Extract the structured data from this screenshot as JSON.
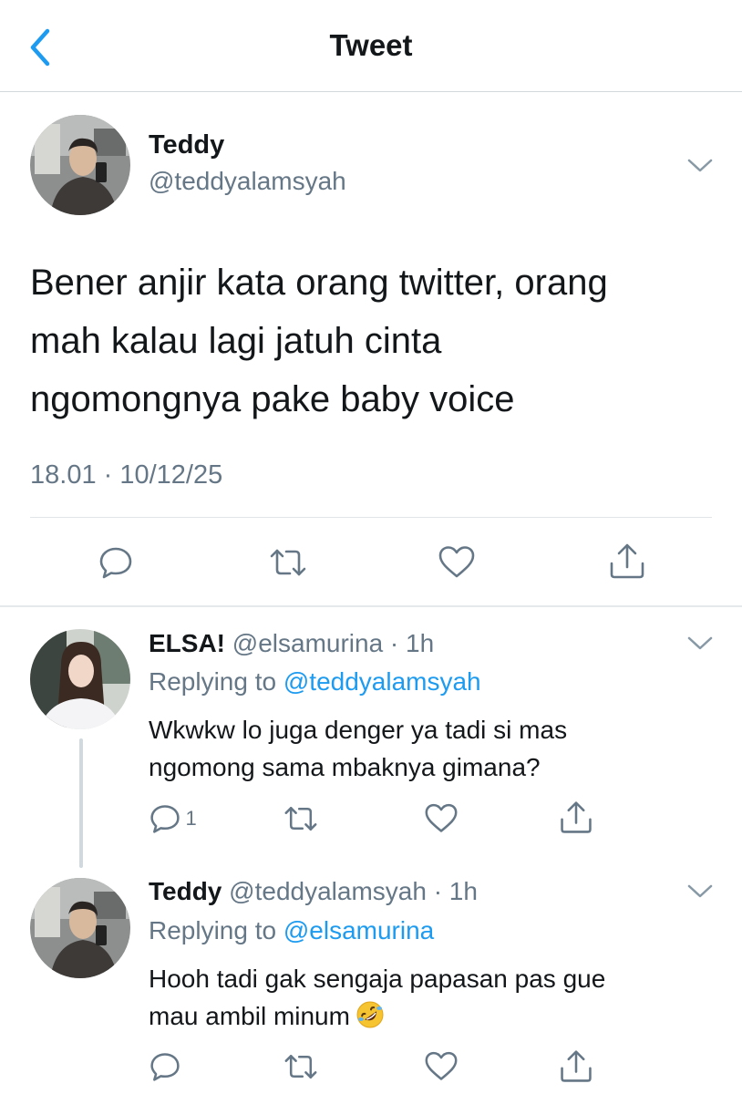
{
  "header": {
    "title": "Tweet",
    "back_icon": "chevron-left-icon"
  },
  "colors": {
    "accent": "#1d9bf0",
    "secondary_text": "#657786",
    "divider": "#e1e5e8"
  },
  "main_tweet": {
    "author_name": "Teddy",
    "handle": "@teddyalamsyah",
    "text_lines": [
      "Bener anjir kata orang twitter, orang",
      "mah kalau lagi jatuh cinta",
      "ngomongnya pake baby voice"
    ],
    "timestamp": "18.01 · 10/12/25",
    "actions": [
      "reply-icon",
      "retweet-icon",
      "like-icon",
      "share-icon"
    ]
  },
  "replies": [
    {
      "author_name": "ELSA!",
      "handle_time": "@elsamurina · 1h",
      "replying_prefix": "Replying to",
      "replying_to": "@teddyalamsyah",
      "text_lines": [
        "Wkwkw lo juga denger ya tadi si mas",
        "ngomong sama mbaknya gimana?"
      ],
      "reply_count": "1"
    },
    {
      "author_name": "Teddy",
      "handle_time": "@teddyalamsyah · 1h",
      "replying_prefix": "Replying to",
      "replying_to": "@elsamurina",
      "text_lines": [
        "Hooh tadi gak sengaja papasan pas gue",
        "mau ambil minum"
      ],
      "emoji": "rolling-on-floor-laughing-emoji"
    }
  ]
}
